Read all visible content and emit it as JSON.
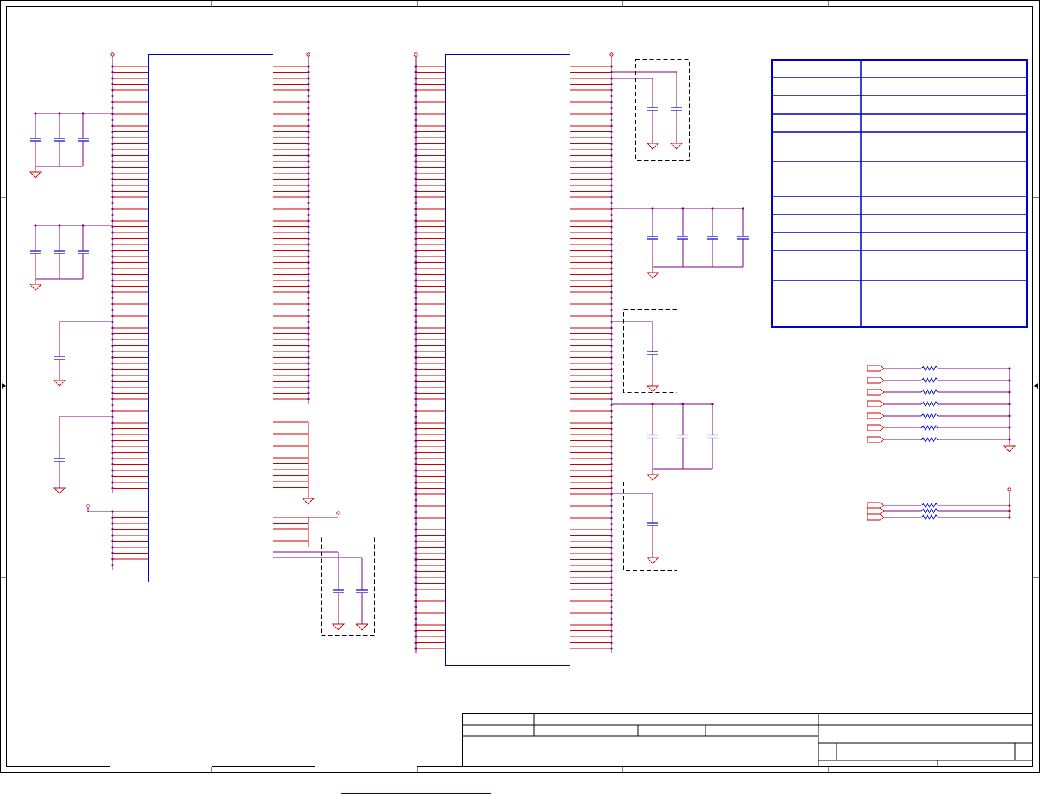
{
  "colors": {
    "border": "#000000",
    "ic_outline": "#0000cc",
    "pin_wire": "#cc0000",
    "net_wire": "#800080",
    "capacitor": "#0000cc",
    "ground": "#cc0000",
    "dashed_box": "#000000",
    "table_border": "#0000cc",
    "resistor": "#0000cc",
    "link": "#0000cc"
  },
  "icons": {
    "ground": "ground-symbol-icon",
    "capacitor": "capacitor-symbol-icon",
    "resistor": "resistor-symbol-icon",
    "port": "port-symbol-icon",
    "power": "power-pin-icon"
  }
}
